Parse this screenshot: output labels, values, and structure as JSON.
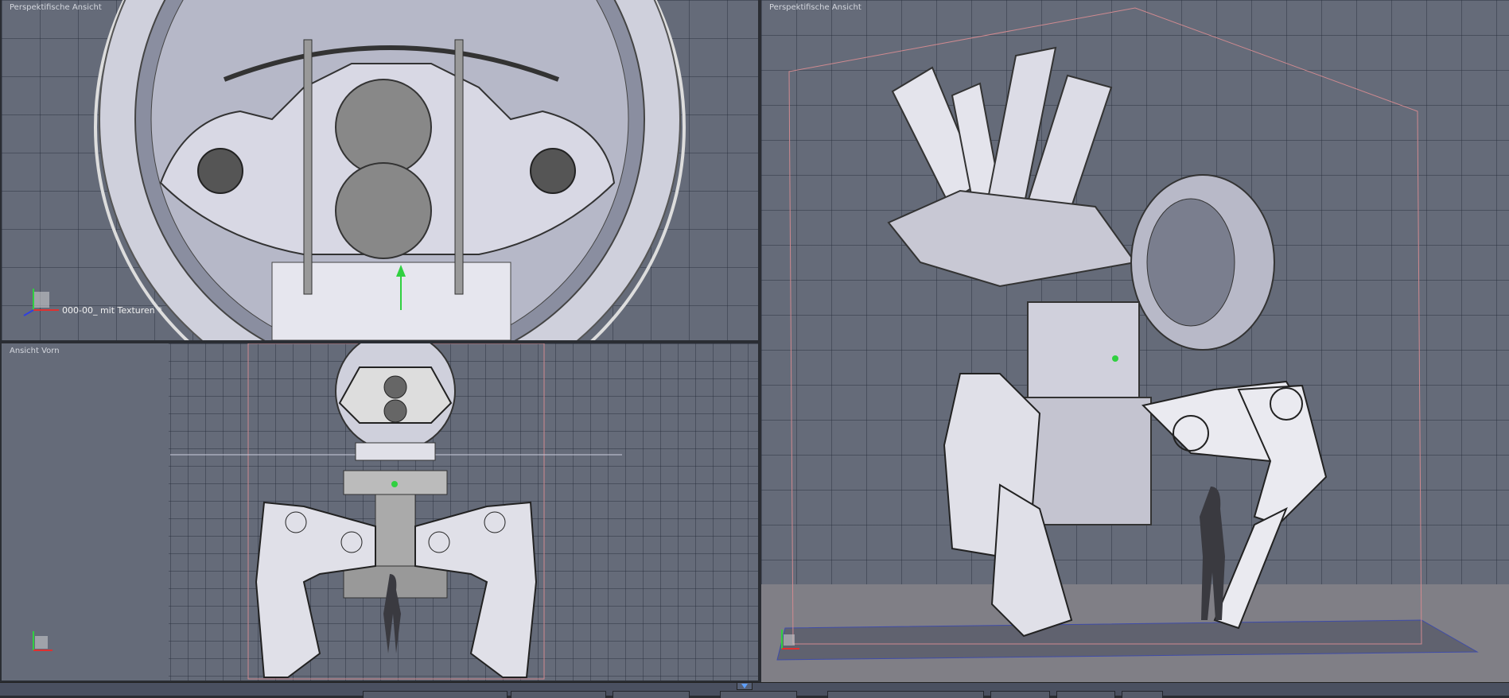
{
  "viewports": {
    "top_left": {
      "label": "Perspektifische Ansicht",
      "object_name": "000-00_ mit Texturen *"
    },
    "bottom_left": {
      "label": "Ansicht Vorn"
    },
    "right": {
      "label": "Perspektifische Ansicht"
    }
  },
  "colors": {
    "viewport_bg": "#656b79",
    "mesh": "#e4e4ec",
    "bounding_box": "#d08a90",
    "axis_x": "#e03030",
    "axis_y": "#30d040",
    "axis_z": "#3040e0"
  }
}
